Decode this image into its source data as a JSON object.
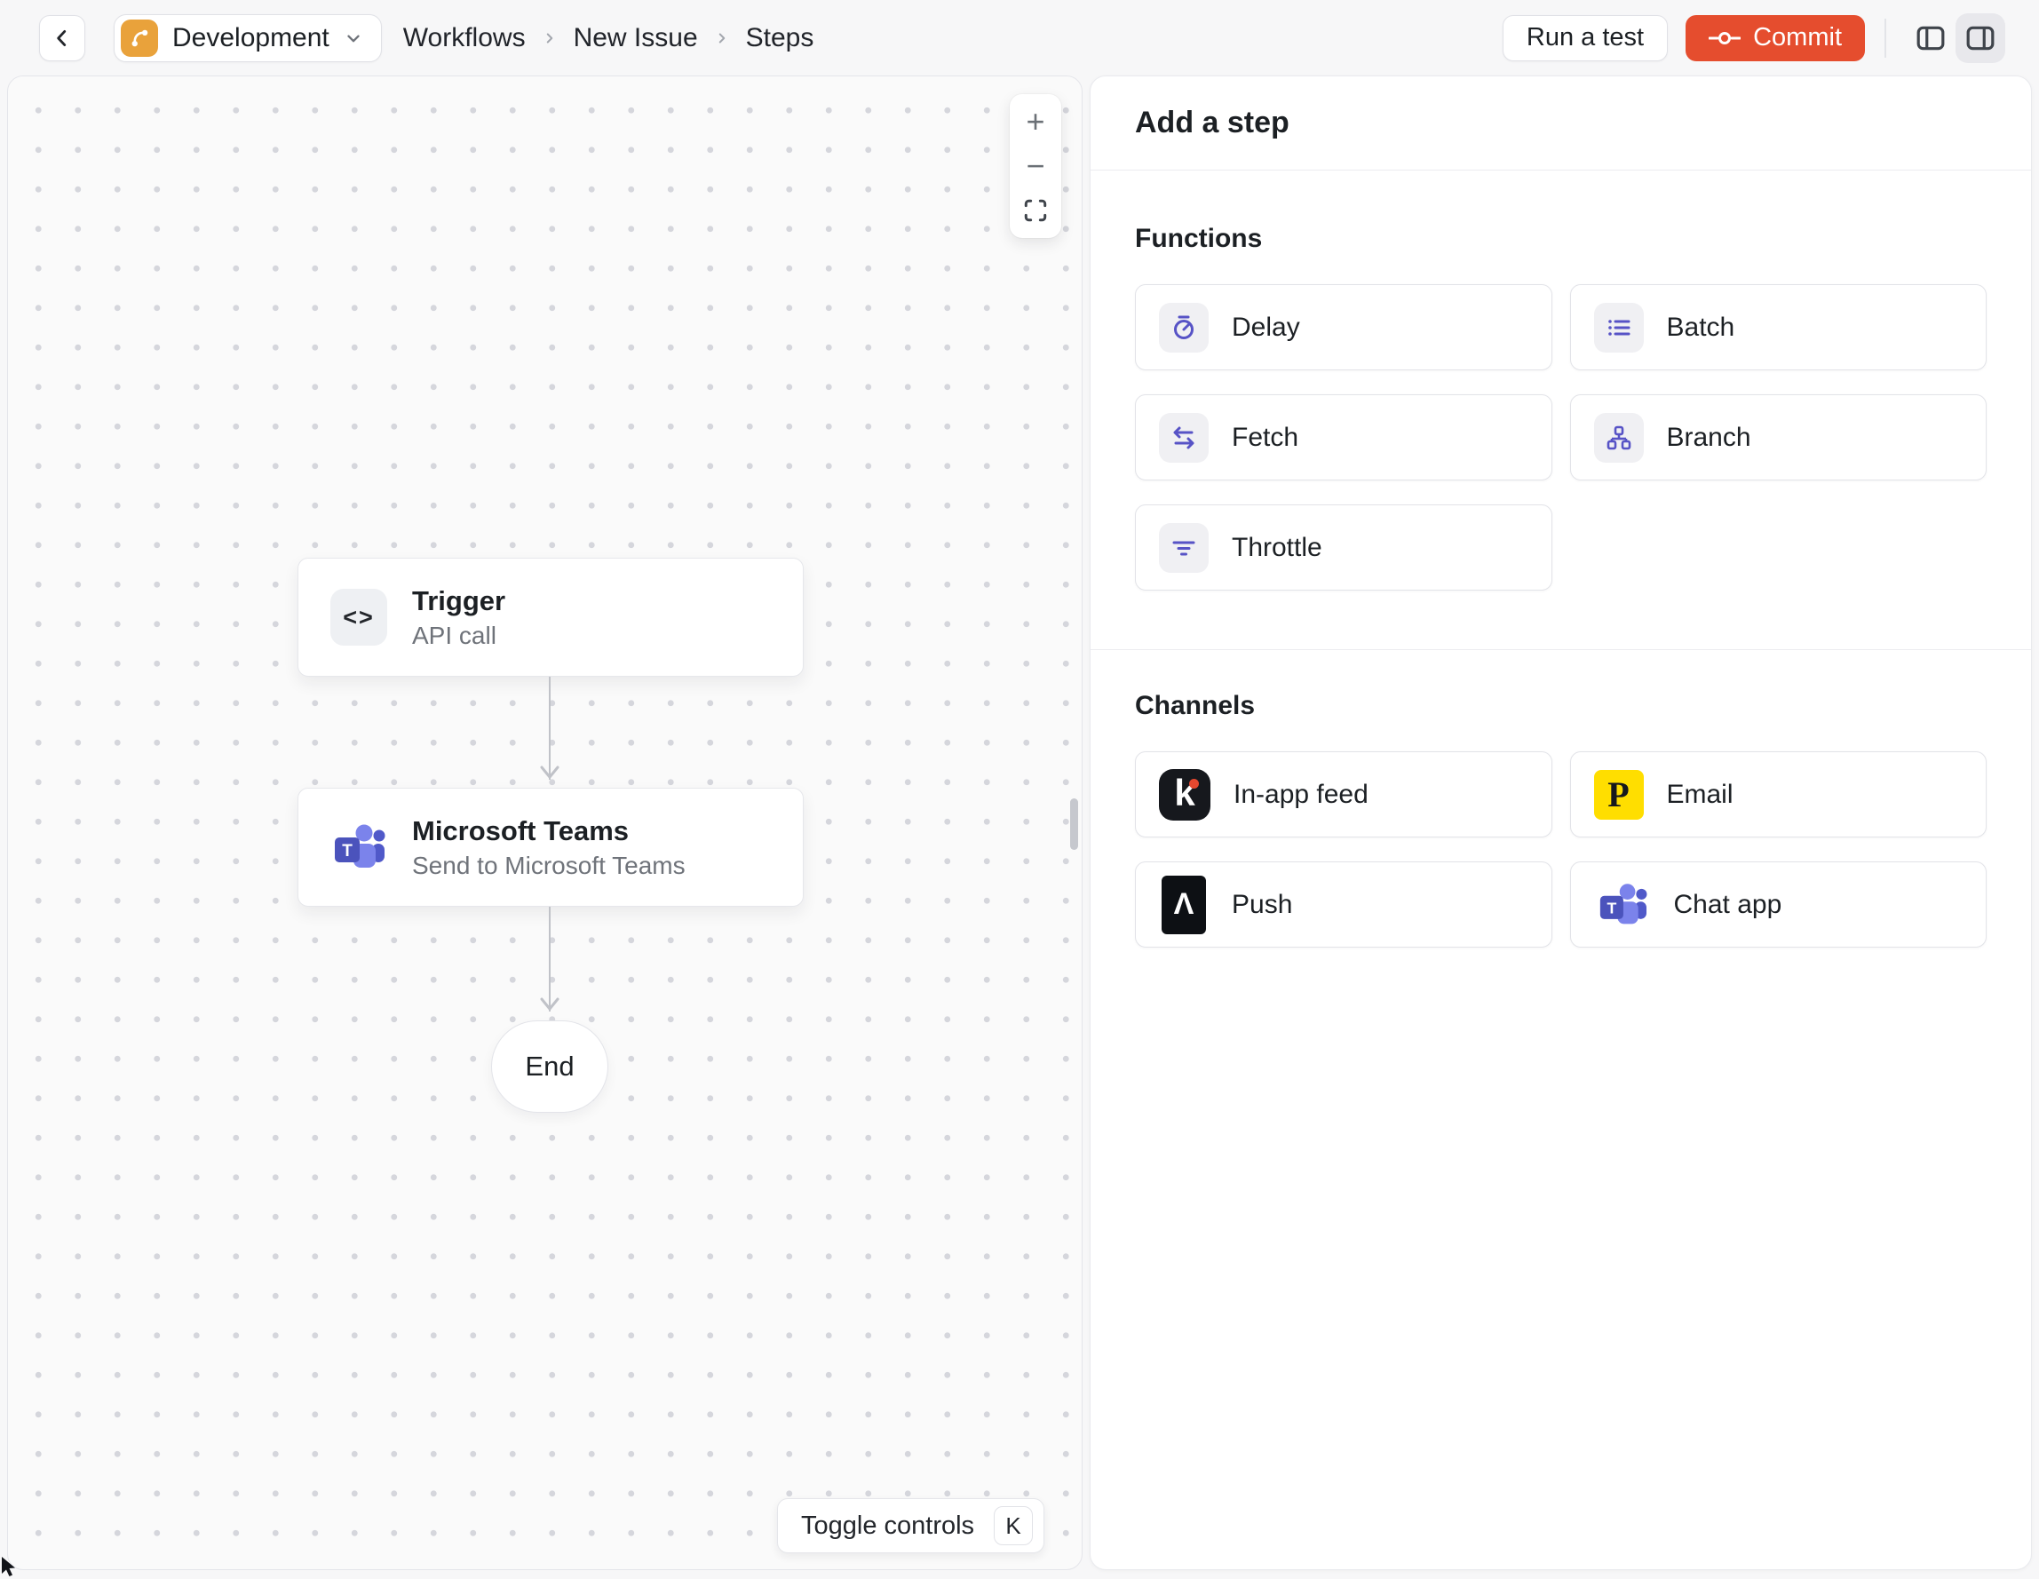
{
  "topbar": {
    "environment": "Development",
    "breadcrumbs": [
      "Workflows",
      "New Issue",
      "Steps"
    ],
    "run_test_label": "Run a test",
    "commit_label": "Commit"
  },
  "canvas": {
    "nodes": {
      "trigger": {
        "title": "Trigger",
        "subtitle": "API call"
      },
      "teams": {
        "title": "Microsoft Teams",
        "subtitle": "Send to Microsoft Teams"
      },
      "end": {
        "label": "End"
      }
    },
    "toggle_controls": {
      "label": "Toggle controls",
      "shortcut": "K"
    }
  },
  "panel": {
    "title": "Add a step",
    "functions": {
      "label": "Functions",
      "items": [
        {
          "label": "Delay",
          "icon": "stopwatch-icon"
        },
        {
          "label": "Batch",
          "icon": "list-icon"
        },
        {
          "label": "Fetch",
          "icon": "swap-arrows-icon"
        },
        {
          "label": "Branch",
          "icon": "hierarchy-icon"
        },
        {
          "label": "Throttle",
          "icon": "funnel-lines-icon"
        }
      ]
    },
    "channels": {
      "label": "Channels",
      "items": [
        {
          "label": "In-app feed",
          "icon": "knock-logo-icon"
        },
        {
          "label": "Email",
          "icon": "postmark-logo-icon"
        },
        {
          "label": "Push",
          "icon": "expo-logo-icon"
        },
        {
          "label": "Chat app",
          "icon": "microsoft-teams-logo-icon"
        }
      ]
    }
  },
  "icons": {
    "trigger_glyph": "<>",
    "zoom_in_glyph": "+",
    "zoom_out_glyph": "−",
    "knock_glyph": "k",
    "postmark_glyph": "P",
    "expo_glyph": "Λ",
    "teams_glyph": "T"
  },
  "colors": {
    "commit_button": "#E54D2E",
    "function_icon_accent": "#5753C6",
    "environment_badge": "#E9A23B",
    "knock_black": "#16181D",
    "knock_dot_red": "#E5482F",
    "postmark_yellow": "#FFDE00",
    "teams_dark": "#4B53BC",
    "teams_mid": "#5059C9",
    "teams_light": "#7B83EB",
    "canvas_dot": "#D5D6DC"
  }
}
